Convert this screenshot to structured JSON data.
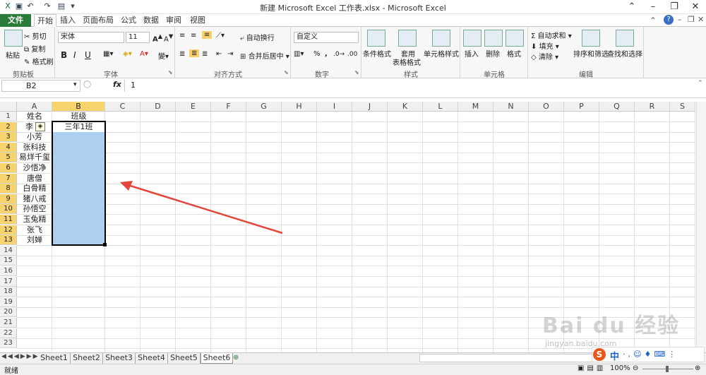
{
  "window": {
    "title": "新建 Microsoft Excel 工作表.xlsx - Microsoft Excel"
  },
  "tabs": [
    "文件",
    "开始",
    "插入",
    "页面布局",
    "公式",
    "数据",
    "审阅",
    "视图"
  ],
  "ribbon": {
    "clipboard": {
      "paste": "粘贴",
      "cut": "剪切",
      "copy": "复制",
      "format_painter": "格式刷",
      "group": "剪贴板"
    },
    "font": {
      "name": "宋体",
      "size": "11",
      "bold": "B",
      "italic": "I",
      "underline": "U",
      "group": "字体"
    },
    "align": {
      "wrap": "自动换行",
      "merge": "合并后居中",
      "group": "对齐方式"
    },
    "number": {
      "format": "自定义",
      "percent": "%",
      "comma": ",",
      "group": "数字"
    },
    "styles": {
      "cond": "条件格式",
      "table": "套用",
      "table2": "表格格式",
      "cell": "单元格样式",
      "group": "样式"
    },
    "cells": {
      "insert": "插入",
      "delete": "删除",
      "format": "格式",
      "group": "单元格"
    },
    "editing": {
      "autosum": "自动求和",
      "fill": "填充",
      "clear": "清除",
      "sort": "排序和筛选",
      "find": "查找和选择",
      "group": "编辑"
    }
  },
  "formula_bar": {
    "name_box": "B2",
    "fx": "fx",
    "value": "1"
  },
  "columns": [
    "A",
    "B",
    "C",
    "D",
    "E",
    "F",
    "G",
    "H",
    "I",
    "J",
    "K",
    "L",
    "M",
    "N",
    "O",
    "P",
    "Q",
    "R",
    "S"
  ],
  "rows": [
    "1",
    "2",
    "3",
    "4",
    "5",
    "6",
    "7",
    "8",
    "9",
    "10",
    "11",
    "12",
    "13",
    "14",
    "15",
    "16",
    "17",
    "18",
    "19",
    "20",
    "21",
    "22",
    "23"
  ],
  "cells": {
    "A": [
      "姓名",
      "李",
      "小芳",
      "张科技",
      "易烊千玺",
      "沙悟净",
      "唐僧",
      "白骨精",
      "猪八戒",
      "孙悟空",
      "玉兔精",
      "张飞",
      "刘婵"
    ],
    "B1": "班级",
    "B2": "三年1班"
  },
  "sheets": [
    "Sheet1",
    "Sheet2",
    "Sheet3",
    "Sheet4",
    "Sheet5",
    "Sheet6"
  ],
  "active_sheet": "Sheet6",
  "status": {
    "ready": "就绪",
    "zoom": "100%"
  },
  "watermark": {
    "brand": "Bai du 经验",
    "url": "jingyan.baidu.com"
  },
  "ime": {
    "label": "中"
  },
  "colors": {
    "file_tab": "#2a7a3a",
    "selection": "#a9cdef",
    "header_sel": "#f7d36d",
    "arrow": "#e2453a"
  }
}
